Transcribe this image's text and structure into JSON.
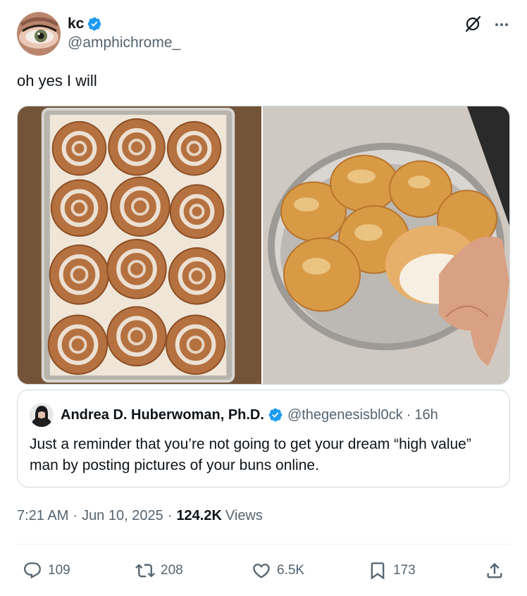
{
  "author": {
    "display_name": "kc",
    "handle": "@amphichrome_",
    "verified": true
  },
  "tweet": {
    "text": "oh yes I will"
  },
  "media": [
    {
      "description_icon": "photo"
    },
    {
      "description_icon": "photo"
    }
  ],
  "quote": {
    "display_name": "Andrea D. Huberwoman, Ph.D.",
    "handle": "@thegenesisbl0ck",
    "separator": "·",
    "time": "16h",
    "text": "Just a reminder that you’re not going to get your dream “high value” man by posting pictures of your buns online."
  },
  "meta": {
    "time": "7:21 AM",
    "date": "Jun 10, 2025",
    "separator": "·",
    "views_count": "124.2K",
    "views_label": "Views"
  },
  "actions": {
    "replies": "109",
    "reposts": "208",
    "likes": "6.5K",
    "bookmarks": "173"
  },
  "colors": {
    "verified_blue": "#1d9bf0",
    "secondary_text": "#536471",
    "primary_text": "#0f1419",
    "border": "#cfd9de"
  },
  "icons": {
    "header": [
      "grok-icon",
      "more-icon"
    ],
    "action_bar": [
      "reply-icon",
      "repost-icon",
      "like-icon",
      "bookmark-icon",
      "share-icon"
    ]
  }
}
